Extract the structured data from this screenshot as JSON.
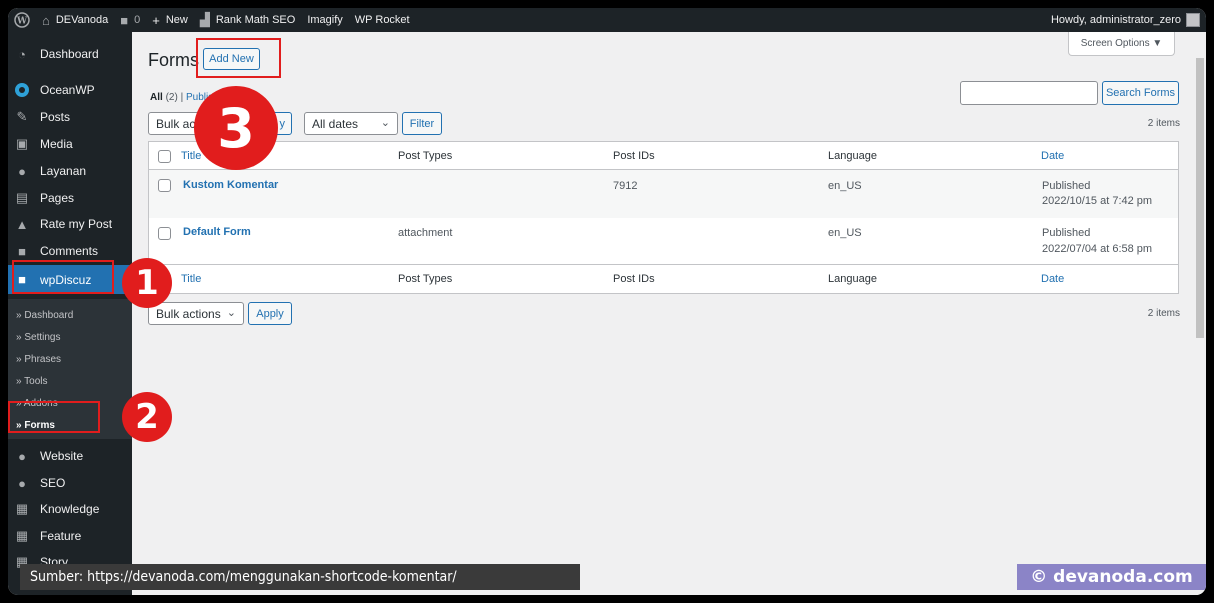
{
  "adminbar": {
    "site_name": "DEVanoda",
    "comments_count": "0",
    "new_label": "New",
    "rank_math": "Rank Math SEO",
    "imagify": "Imagify",
    "wp_rocket": "WP Rocket",
    "howdy": "Howdy, administrator_zero"
  },
  "sidebar": {
    "items": [
      {
        "label": "Dashboard",
        "icon": "gauge-icon"
      },
      {
        "label": "OceanWP",
        "icon": "oceanwp-icon"
      },
      {
        "label": "Posts",
        "icon": "pin-icon"
      },
      {
        "label": "Media",
        "icon": "media-icon"
      },
      {
        "label": "Layanan",
        "icon": "globe-icon"
      },
      {
        "label": "Pages",
        "icon": "pages-icon"
      },
      {
        "label": "Rate my Post",
        "icon": "thumbs-up-icon"
      },
      {
        "label": "Comments",
        "icon": "comment-icon"
      },
      {
        "label": "wpDiscuz",
        "icon": "comment-icon"
      },
      {
        "label": "Website",
        "icon": "globe-icon"
      },
      {
        "label": "SEO",
        "icon": "globe-icon"
      },
      {
        "label": "Knowledge",
        "icon": "film-icon"
      },
      {
        "label": "Feature",
        "icon": "film-icon"
      },
      {
        "label": "Story",
        "icon": "film-icon"
      }
    ],
    "submenu": [
      "» Dashboard",
      "» Settings",
      "» Phrases",
      "» Tools",
      "» Addons",
      "» Forms"
    ]
  },
  "page": {
    "title": "Forms",
    "add_new": "Add New",
    "screen_options": "Screen Options ▼",
    "filter_all": "All",
    "filter_all_count": "(2)",
    "filter_sep": "|",
    "filter_published": "Publish",
    "search_button": "Search Forms",
    "bulk_actions": "Bulk actions",
    "bulk_top_visible": "Bulk acti",
    "apply_top_visible": "y",
    "apply": "Apply",
    "all_dates": "All dates",
    "filter_button": "Filter",
    "items_count": "2 items"
  },
  "table": {
    "columns": [
      "Title",
      "Post Types",
      "Post IDs",
      "Language",
      "Date"
    ],
    "rows": [
      {
        "title": "Kustom Komentar",
        "post_types": "",
        "post_ids": "7912",
        "language": "en_US",
        "status": "Published",
        "date": "2022/10/15 at 7:42 pm"
      },
      {
        "title": "Default Form",
        "post_types": "attachment",
        "post_ids": "",
        "language": "en_US",
        "status": "Published",
        "date": "2022/07/04 at 6:58 pm"
      }
    ]
  },
  "annotations": {
    "step1": "1",
    "step2": "2",
    "step3": "3",
    "color": "#e11d1d"
  },
  "footer": {
    "source": "Sumber:  https://devanoda.com/menggunakan-shortcode-komentar/",
    "copyright": "© devanoda.com"
  }
}
